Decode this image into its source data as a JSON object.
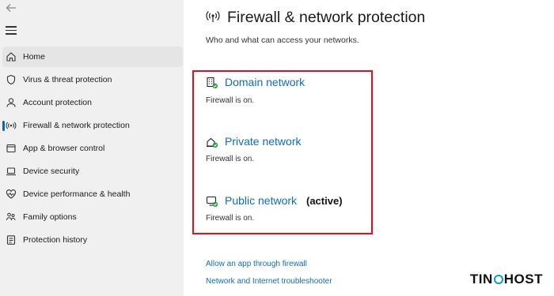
{
  "sidebar": {
    "items": [
      {
        "label": "Home",
        "icon": "home-icon",
        "selected": true
      },
      {
        "label": "Virus & threat protection",
        "icon": "shield-icon"
      },
      {
        "label": "Account protection",
        "icon": "person-icon"
      },
      {
        "label": "Firewall & network protection",
        "icon": "antenna-icon",
        "active": true
      },
      {
        "label": "App & browser control",
        "icon": "app-window-icon"
      },
      {
        "label": "Device security",
        "icon": "laptop-icon"
      },
      {
        "label": "Device performance & health",
        "icon": "heart-icon"
      },
      {
        "label": "Family options",
        "icon": "family-icon"
      },
      {
        "label": "Protection history",
        "icon": "history-icon"
      }
    ]
  },
  "page": {
    "title": "Firewall & network protection",
    "subtitle": "Who and what can access your networks."
  },
  "networks": [
    {
      "name": "Domain network",
      "status": "Firewall is on.",
      "active": ""
    },
    {
      "name": "Private network",
      "status": "Firewall is on.",
      "active": ""
    },
    {
      "name": "Public network",
      "status": "Firewall is on.",
      "active": "(active)"
    }
  ],
  "links": [
    "Allow an app through firewall",
    "Network and Internet troubleshooter"
  ],
  "watermark": {
    "text_left": "TIN",
    "text_right": "HOST"
  },
  "colors": {
    "link": "#0f6cbd",
    "highlight": "#e0101e",
    "accent": "#0067c0",
    "sidebar_bg": "#f0f0f0"
  }
}
